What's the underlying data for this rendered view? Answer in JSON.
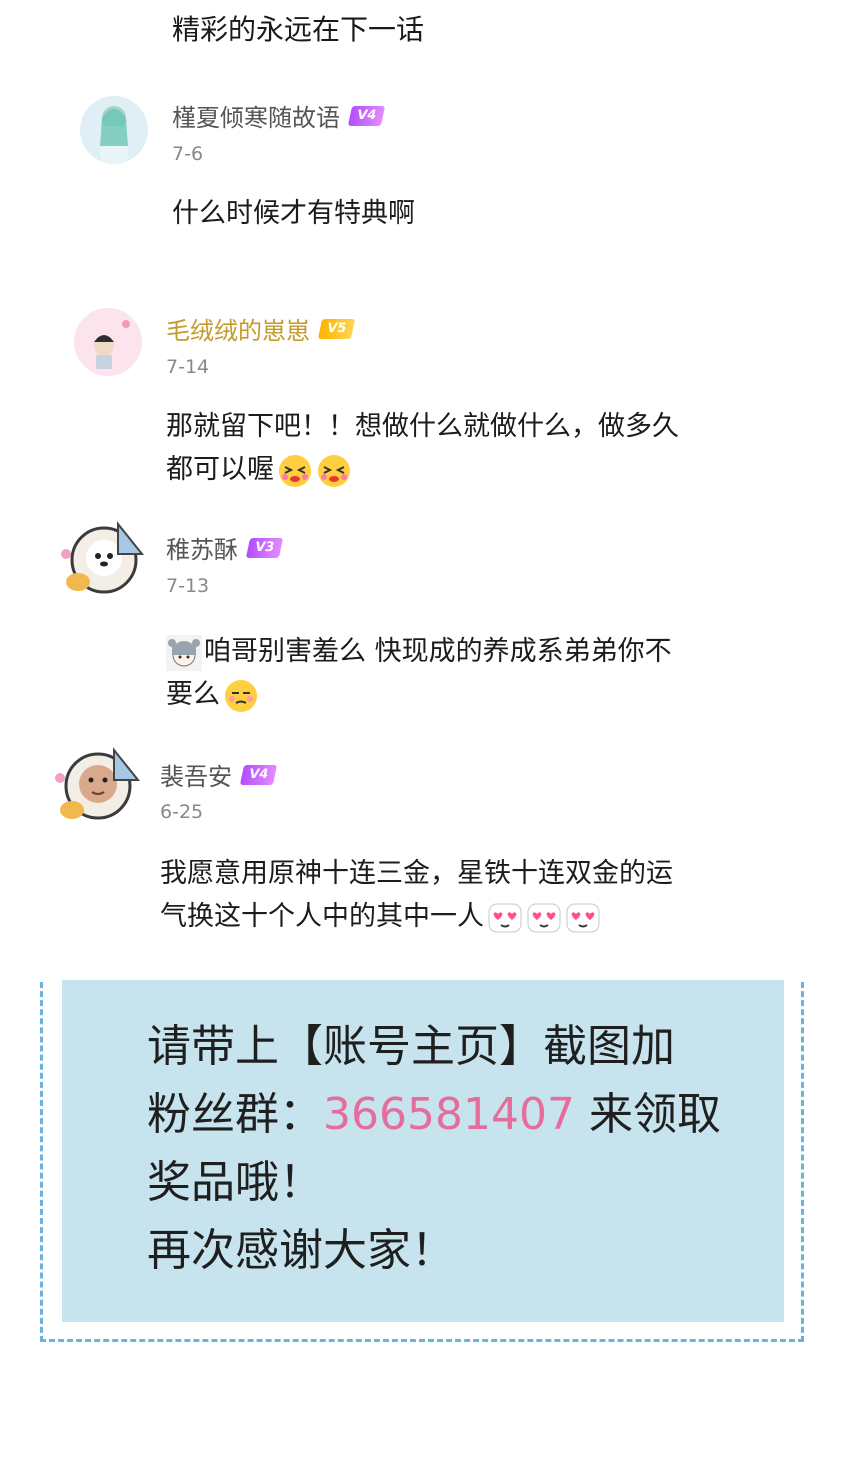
{
  "top_line": "精彩的永远在下一话",
  "comments": [
    {
      "username": "槿夏倾寒随故语",
      "level": "V4",
      "date": "7-6",
      "text": "什么时候才有特典啊",
      "emoji_count": 0
    },
    {
      "username": "毛绒绒的崽崽",
      "level": "V5",
      "date": "7-14",
      "text_line1": "那就留下吧！！想做什么就做什么，做多久",
      "text_line2": "都可以喔",
      "emoji_names": [
        "heart-eyes-squint-emoji",
        "heart-eyes-squint-emoji"
      ]
    },
    {
      "username": "稚苏酥",
      "level": "V3",
      "date": "7-13",
      "text_line1": "咱哥别害羞么 快现成的养成系弟弟你不",
      "text_line2": "要么",
      "emoji_names": [
        "character-sticker-emoji",
        "smug-face-emoji"
      ]
    },
    {
      "username": "裴吾安",
      "level": "V4",
      "date": "6-25",
      "text_line1": "我愿意用原神十连三金，星铁十连双金的运",
      "text_line2": "气换这十个人中的其中一人",
      "emoji_names": [
        "heart-eyes-emoji",
        "heart-eyes-emoji",
        "heart-eyes-emoji"
      ]
    }
  ],
  "notice": {
    "line1": "请带上【账号主页】截图加",
    "line2_prefix": "粉丝群：",
    "group_number": "366581407",
    "line2_suffix": " 来领取",
    "line3": "奖品哦！",
    "line4": "再次感谢大家！"
  },
  "colors": {
    "notice_background": "#c6e3ee",
    "notice_border": "#6ab3dc",
    "group_number": "#e46d9b",
    "badge_purple": "#b34dff",
    "badge_gold": "#ffb300",
    "gold_username": "#c49a2c"
  }
}
